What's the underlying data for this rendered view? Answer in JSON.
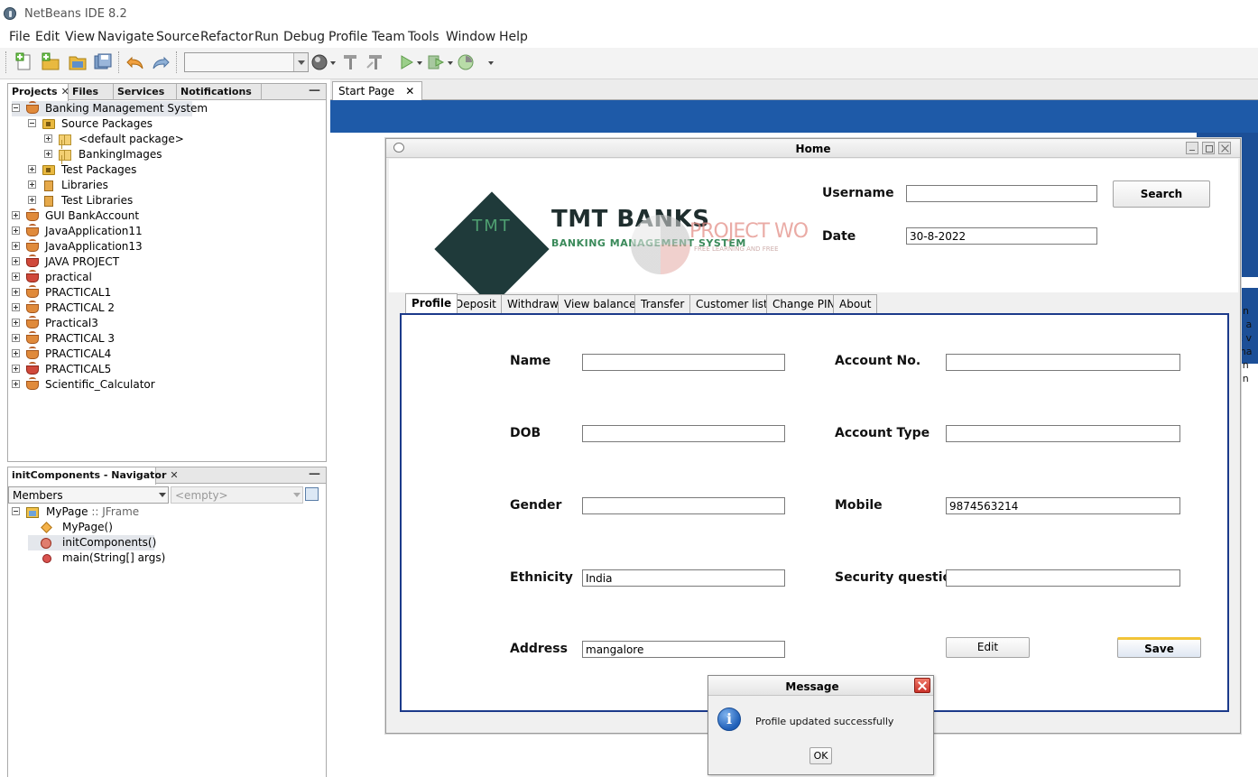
{
  "window": {
    "title": "NetBeans IDE 8.2"
  },
  "menu": [
    "File",
    "Edit",
    "View",
    "Navigate",
    "Source",
    "Refactor",
    "Run",
    "Debug",
    "Profile",
    "Team",
    "Tools",
    "Window",
    "Help"
  ],
  "projects_panel": {
    "tabs": [
      "Projects",
      "Files",
      "Services",
      "Notifications"
    ],
    "tree": [
      {
        "label": "Banking Management System",
        "icon": "coffee-cup-icon",
        "level": 0,
        "expanded": true
      },
      {
        "label": "Source Packages",
        "icon": "source-packages-icon",
        "level": 1,
        "expanded": true
      },
      {
        "label": "<default package>",
        "icon": "package-icon",
        "level": 2
      },
      {
        "label": "BankingImages",
        "icon": "package-icon",
        "level": 2
      },
      {
        "label": "Test Packages",
        "icon": "test-packages-icon",
        "level": 1
      },
      {
        "label": "Libraries",
        "icon": "libraries-icon",
        "level": 1
      },
      {
        "label": "Test Libraries",
        "icon": "libraries-icon",
        "level": 1
      },
      {
        "label": "GUI BankAccount",
        "icon": "coffee-cup-icon",
        "level": 0
      },
      {
        "label": "JavaApplication11",
        "icon": "coffee-cup-icon",
        "level": 0
      },
      {
        "label": "JavaApplication13",
        "icon": "coffee-cup-icon",
        "level": 0
      },
      {
        "label": "JAVA PROJECT",
        "icon": "coffee-cup-error-icon",
        "level": 0
      },
      {
        "label": "practical",
        "icon": "coffee-cup-error-icon",
        "level": 0
      },
      {
        "label": "PRACTICAL1",
        "icon": "coffee-cup-icon",
        "level": 0
      },
      {
        "label": "PRACTICAL 2",
        "icon": "coffee-cup-icon",
        "level": 0
      },
      {
        "label": "Practical3",
        "icon": "coffee-cup-icon",
        "level": 0
      },
      {
        "label": "PRACTICAL 3",
        "icon": "coffee-cup-icon",
        "level": 0
      },
      {
        "label": "PRACTICAL4",
        "icon": "coffee-cup-icon",
        "level": 0
      },
      {
        "label": "PRACTICAL5",
        "icon": "coffee-cup-error-icon",
        "level": 0
      },
      {
        "label": "Scientific_Calculator",
        "icon": "coffee-cup-icon",
        "level": 0
      }
    ]
  },
  "navigator_panel": {
    "tab": "initComponents - Navigator",
    "filter_value": "Members",
    "second_combo": "<empty>",
    "root": {
      "label": "MyPage",
      "type": ":: JFrame"
    },
    "members": [
      "MyPage()",
      "initComponents()",
      "main(String[] args)"
    ]
  },
  "editor": {
    "tab": "Start Page",
    "snippet": [
      "un",
      "g a",
      "E v",
      "ma",
      "an",
      "an"
    ]
  },
  "home_frame": {
    "title": "Home",
    "logo": {
      "mark": "TMT",
      "title": "TMT BANKS",
      "subtitle": "BANKING MANAGEMENT SYSTEM"
    },
    "watermark": {
      "text": "PROJECT WO",
      "sub": "FREE LEARNING AND FREE"
    },
    "username_label": "Username",
    "username_value": "",
    "date_label": "Date",
    "date_value": "30-8-2022",
    "search_label": "Search",
    "tabs": [
      "Profile",
      "Deposit",
      "Withdraw",
      "View balance",
      "Transfer",
      "Customer list",
      "Change PIN",
      "About"
    ],
    "active_tab": "Profile",
    "form": {
      "name": {
        "label": "Name",
        "value": ""
      },
      "dob": {
        "label": "DOB",
        "value": ""
      },
      "gender": {
        "label": "Gender",
        "value": ""
      },
      "ethnicity": {
        "label": "Ethnicity",
        "value": "India"
      },
      "address": {
        "label": "Address",
        "value": "mangalore"
      },
      "account_no": {
        "label": "Account No.",
        "value": ""
      },
      "account_type": {
        "label": "Account Type",
        "value": ""
      },
      "mobile": {
        "label": "Mobile",
        "value": "9874563214"
      },
      "security_question": {
        "label": "Security question",
        "value": ""
      },
      "edit_label": "Edit",
      "save_label": "Save"
    }
  },
  "message_dialog": {
    "title": "Message",
    "text": "Profile updated successfully",
    "ok_label": "OK"
  }
}
